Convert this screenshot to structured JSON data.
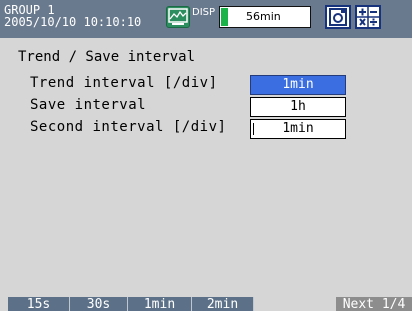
{
  "header": {
    "group": "GROUP 1",
    "datetime": "2005/10/10 10:10:10",
    "disp_label": "DISP",
    "duration": "56min",
    "save_icon": "floppy-save-icon",
    "calc_icon": "plus-minus-times-divide-icon"
  },
  "panel": {
    "title": "Trend / Save interval",
    "rows": [
      {
        "label": "Trend interval [/div]",
        "value": "1min"
      },
      {
        "label": "Save interval",
        "value": "1h"
      },
      {
        "label": "Second interval [/div]",
        "value": "1min"
      }
    ]
  },
  "softkeys": [
    "15s",
    "30s",
    "1min",
    "2min",
    "Next 1/4"
  ],
  "colors": {
    "header_bg": "#6a7a8e",
    "panel_bg": "#d6d6d6",
    "selected_bg": "#3b6ee0",
    "softkey_bg": "#5c7188",
    "softkey_next_bg": "#8d8d8d",
    "progress_green": "#19b34a",
    "icon_border": "#16337c"
  }
}
